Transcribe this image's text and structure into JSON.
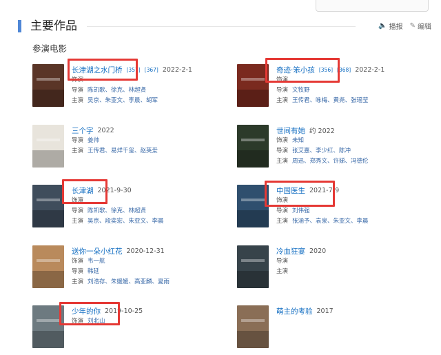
{
  "header": {
    "section_title": "主要作品",
    "actions": [
      {
        "icon": "speaker-icon",
        "label": "播报"
      },
      {
        "icon": "pencil-icon",
        "label": "编辑"
      }
    ],
    "subsection_title": "参演电影"
  },
  "films": [
    {
      "title": "长津湖之水门桥",
      "sup": "[357]",
      "sup2": "[367]",
      "year": "2022-2-1",
      "roleLabel": "饰演",
      "role": "",
      "directorLabel": "导演",
      "directors": "陈凯歌、徐克、林超贤",
      "castLabel": "主演",
      "cast": "吴京、朱亚文、李晨、胡军",
      "poster": "#5a3527"
    },
    {
      "title": "奇迹·笨小孩",
      "sup": "[356]",
      "sup2": "[368]",
      "year": "2022-2-1",
      "roleLabel": "饰演",
      "role": "",
      "directorLabel": "导演",
      "directors": "文牧野",
      "castLabel": "主演",
      "cast": "王传君、咏梅、黄尧、张瑶莹",
      "poster": "#7a2a1f"
    },
    {
      "title": "三个字",
      "sup": "",
      "sup2": "",
      "year": "2022",
      "roleLabel": "",
      "role": "",
      "directorLabel": "导演",
      "directors": "姜帅",
      "castLabel": "主演",
      "cast": "王传君、易烊千玺、赵英爱",
      "poster": "#e8e4dc"
    },
    {
      "title": "世间有她",
      "sup": "",
      "sup2": "",
      "year": "约 2022",
      "roleLabel": "饰演",
      "role": "未知",
      "directorLabel": "导演",
      "directors": "张艾嘉、李少红、陈冲",
      "castLabel": "主演",
      "cast": "周迅、郑秀文、许娣、冯德伦",
      "poster": "#2c3a2a"
    },
    {
      "title": "长津湖",
      "sup": "",
      "sup2": "",
      "year": "2021-9-30",
      "roleLabel": "饰演",
      "role": "",
      "directorLabel": "导演",
      "directors": "陈凯歌、徐克、林超贤",
      "castLabel": "主演",
      "cast": "吴京、段奕宏、朱亚文、李晨",
      "poster": "#3f4d5c"
    },
    {
      "title": "中国医生",
      "sup": "",
      "sup2": "",
      "year": "2021-7-9",
      "roleLabel": "饰演",
      "role": "",
      "directorLabel": "导演",
      "directors": "刘伟强",
      "castLabel": "主演",
      "cast": "张涵予、袁泉、朱亚文、李晨",
      "poster": "#2f4f6e"
    },
    {
      "title": "送你一朵小红花",
      "sup": "",
      "sup2": "",
      "year": "2020-12-31",
      "roleLabel": "饰演",
      "role": "韦一航",
      "directorLabel": "导演",
      "directors": "韩延",
      "castLabel": "主演",
      "cast": "刘浩存、朱媛媛、高亚麟、夏雨",
      "poster": "#b98a5c"
    },
    {
      "title": "冷血狂宴",
      "sup": "",
      "sup2": "",
      "year": "2020",
      "roleLabel": "",
      "role": "",
      "directorLabel": "导演",
      "directors": "",
      "castLabel": "主演",
      "cast": "",
      "poster": "#37434a"
    },
    {
      "title": "少年的你",
      "sup": "",
      "sup2": "",
      "year": "2019-10-25",
      "roleLabel": "饰演",
      "role": "刘北山",
      "directorLabel": "",
      "directors": "",
      "castLabel": "",
      "cast": "",
      "poster": "#6d7a80"
    },
    {
      "title": "萌主的考验",
      "sup": "",
      "sup2": "",
      "year": "2017",
      "roleLabel": "",
      "role": "",
      "directorLabel": "",
      "directors": "",
      "castLabel": "",
      "cast": "",
      "poster": "#8a6e56"
    }
  ],
  "colors": {
    "accent": "#4f87d6",
    "link": "#136ec2",
    "highlight": "#e53935"
  }
}
